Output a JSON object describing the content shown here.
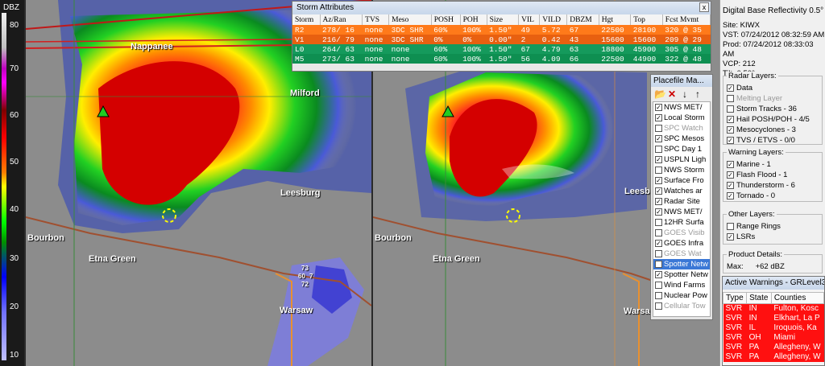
{
  "scale": {
    "title": "DBZ",
    "ticks": [
      "80",
      "70",
      "60",
      "50",
      "40",
      "30",
      "20",
      "10"
    ]
  },
  "places_left": {
    "milford": "Milford",
    "leesburg": "Leesburg",
    "bourbon": "Bourbon",
    "etna_green": "Etna Green",
    "warsaw": "Warsaw",
    "nappanee": "Nappanee"
  },
  "places_right": {
    "leesburg": "Leesb",
    "bourbon": "Bourbon",
    "etna_green": "Etna Green",
    "warsaw": "Warsa"
  },
  "spotter": {
    "top": "73",
    "mid": "60",
    "val": "7",
    "bot": "72"
  },
  "storm_window": {
    "title": "Storm Attributes",
    "close": "x",
    "columns": [
      "Storm",
      "Az/Ran",
      "TVS",
      "Meso",
      "POSH",
      "POH",
      "Size",
      "VIL",
      "VILD",
      "DBZM",
      "Hgt",
      "Top",
      "Fcst Mvmt"
    ],
    "rows": [
      [
        "R2",
        "278/ 16",
        "none",
        "3DC SHR",
        "60%",
        "100%",
        "1.50\"",
        "49",
        "5.72",
        "67",
        "22500",
        "28100",
        "320 @ 35"
      ],
      [
        "V1",
        "216/ 79",
        "none",
        "3DC SHR",
        "0%",
        "0%",
        "0.00\"",
        "2",
        "0.42",
        "43",
        "15600",
        "15600",
        "209 @ 29"
      ],
      [
        "L0",
        "264/ 63",
        "none",
        "none",
        "60%",
        "100%",
        "1.50\"",
        "67",
        "4.79",
        "63",
        "18800",
        "45900",
        "305 @ 48"
      ],
      [
        "M5",
        "273/ 63",
        "none",
        "none",
        "60%",
        "100%",
        "1.50\"",
        "56",
        "4.09",
        "66",
        "22500",
        "44900",
        "322 @ 48"
      ]
    ]
  },
  "placefile": {
    "title": "Placefile Ma...",
    "tools": [
      "open-icon",
      "delete-icon",
      "down-arrow-icon",
      "up-arrow-icon"
    ],
    "items": [
      {
        "label": "NWS MET/",
        "checked": true,
        "dim": false
      },
      {
        "label": "Local Storm",
        "checked": true,
        "dim": false
      },
      {
        "label": "SPC Watch",
        "checked": false,
        "dim": true
      },
      {
        "label": "SPC Mesos",
        "checked": true,
        "dim": false
      },
      {
        "label": "SPC Day 1",
        "checked": false,
        "dim": false
      },
      {
        "label": "USPLN Ligh",
        "checked": true,
        "dim": false
      },
      {
        "label": "NWS Storm",
        "checked": false,
        "dim": false
      },
      {
        "label": "Surface Fro",
        "checked": true,
        "dim": false
      },
      {
        "label": "Watches ar",
        "checked": true,
        "dim": false
      },
      {
        "label": "Radar Site",
        "checked": true,
        "dim": false
      },
      {
        "label": "NWS MET/",
        "checked": true,
        "dim": false
      },
      {
        "label": "12HR Surfa",
        "checked": false,
        "dim": false
      },
      {
        "label": "GOES Visib",
        "checked": false,
        "dim": true
      },
      {
        "label": "GOES Infra",
        "checked": true,
        "dim": false
      },
      {
        "label": "GOES Wat",
        "checked": false,
        "dim": true
      },
      {
        "label": "Spotter Netw",
        "checked": false,
        "dim": false,
        "selected": true
      },
      {
        "label": "Spotter Netw",
        "checked": true,
        "dim": false
      },
      {
        "label": "Wind Farms",
        "checked": false,
        "dim": false
      },
      {
        "label": "Nuclear Pow",
        "checked": false,
        "dim": false
      },
      {
        "label": "Cellular Tow",
        "checked": false,
        "dim": true
      }
    ]
  },
  "product": {
    "title": "Digital Base Reflectivity 0.5°",
    "site": "Site:  KIWX",
    "vst": "VST:  07/24/2012  08:32:59 AM",
    "prod": "Prod: 07/24/2012  08:33:03 AM",
    "vcp": "VCP:  212",
    "tilt": "Tilt:  0.50°"
  },
  "radar_layers": {
    "title": "Radar Layers:",
    "items": [
      {
        "label": "Data",
        "checked": true,
        "dim": false
      },
      {
        "label": "Melting Layer",
        "checked": false,
        "dim": true
      },
      {
        "label": "Storm Tracks - 36",
        "checked": false,
        "dim": false
      },
      {
        "label": "Hail POSH/POH - 4/5",
        "checked": true,
        "dim": false
      },
      {
        "label": "Mesocyclones - 3",
        "checked": true,
        "dim": false
      },
      {
        "label": "TVS / ETVS - 0/0",
        "checked": true,
        "dim": false
      }
    ]
  },
  "warning_layers": {
    "title": "Warning Layers:",
    "items": [
      {
        "label": "Marine - 1",
        "checked": true
      },
      {
        "label": "Flash Flood - 1",
        "checked": true
      },
      {
        "label": "Thunderstorm - 6",
        "checked": true
      },
      {
        "label": "Tornado - 0",
        "checked": true
      }
    ]
  },
  "other_layers": {
    "title": "Other Layers:",
    "items": [
      {
        "label": "Range Rings",
        "checked": false
      },
      {
        "label": "LSRs",
        "checked": true
      }
    ]
  },
  "product_details": {
    "title": "Product Details:",
    "max_label": "Max:",
    "max_value": "+62 dBZ"
  },
  "active_warnings": {
    "title": "Active Warnings - GRLevel3",
    "columns": [
      "Type",
      "State",
      "Counties"
    ],
    "rows": [
      [
        "SVR",
        "IN",
        "Fulton, Kosc"
      ],
      [
        "SVR",
        "IN",
        "Elkhart, La P"
      ],
      [
        "SVR",
        "IL",
        "Iroquois, Ka"
      ],
      [
        "SVR",
        "OH",
        "Miami"
      ],
      [
        "SVR",
        "PA",
        "Allegheny, W"
      ],
      [
        "SVR",
        "PA",
        "Allegheny, W"
      ]
    ]
  },
  "colors": {
    "storm_orange": "#ff7a1a",
    "storm_green": "#159a5c",
    "warning_red": "#ff1010"
  }
}
